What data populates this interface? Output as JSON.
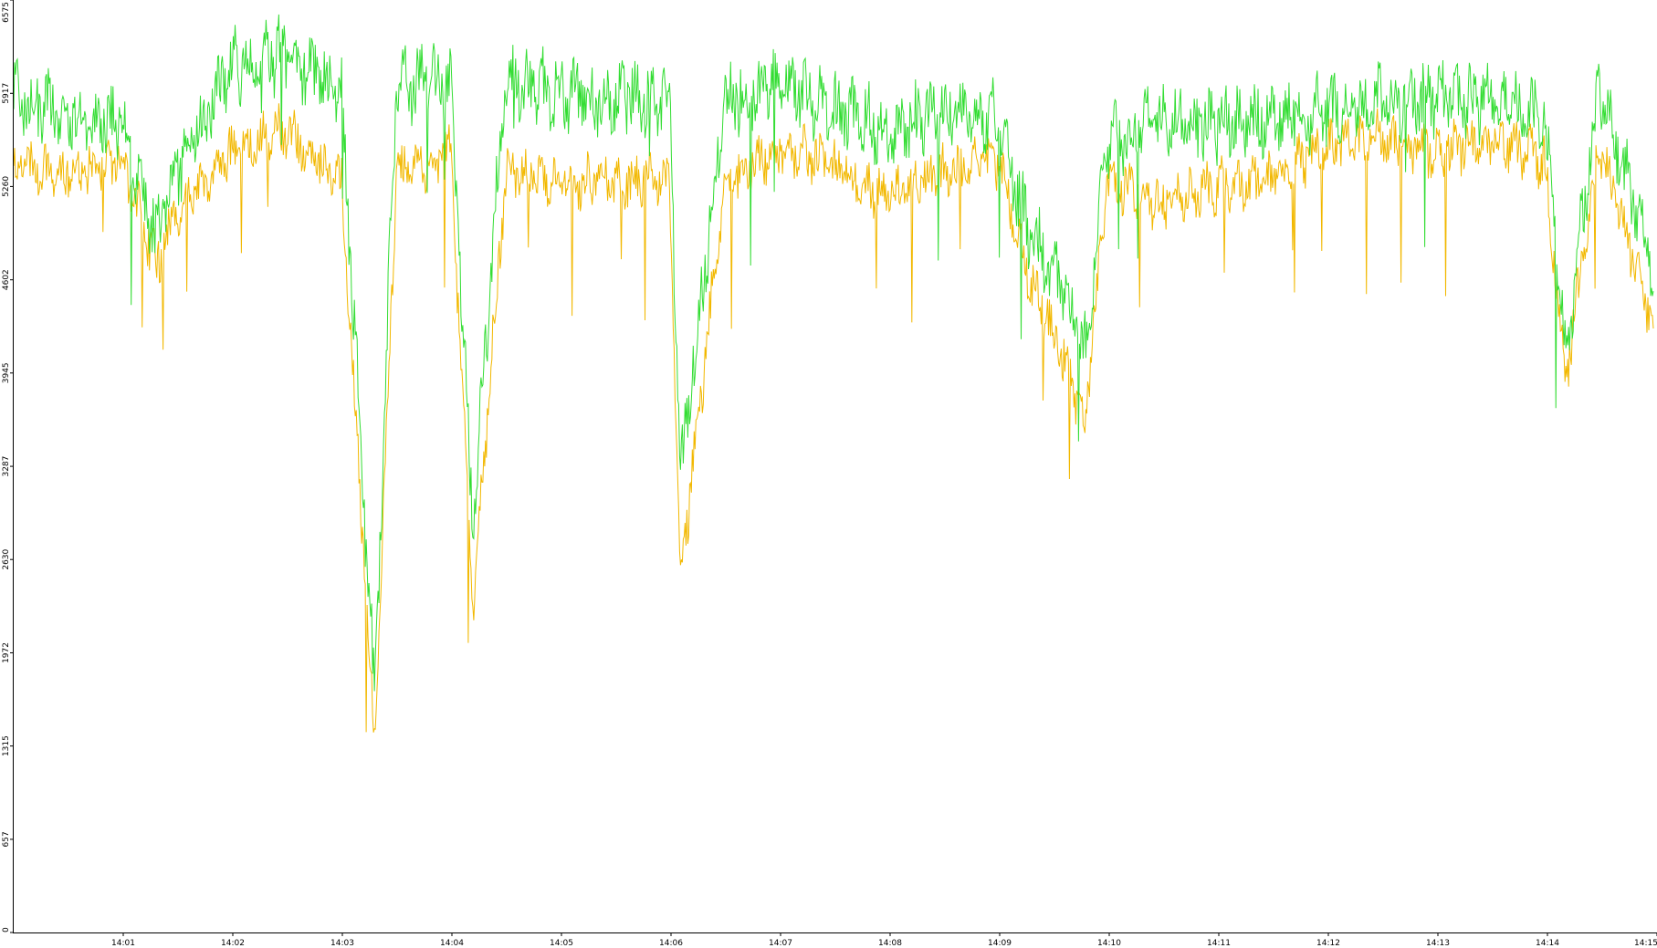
{
  "chart_data": {
    "type": "line",
    "title": "",
    "xlabel": "",
    "ylabel": "",
    "ylim": [
      0,
      6575
    ],
    "yticks": [
      0,
      657,
      1315,
      1972,
      2630,
      3287,
      3945,
      4602,
      5260,
      5917,
      6575
    ],
    "xticks": [
      "14:01",
      "14:02",
      "14:03",
      "14:04",
      "14:05",
      "14:06",
      "14:07",
      "14:08",
      "14:09",
      "14:10",
      "14:11",
      "14:12",
      "14:13",
      "14:14",
      "14:15"
    ],
    "x_minutes": [
      0,
      0.5,
      1.0,
      1.3,
      1.5,
      2.0,
      2.5,
      3.0,
      3.3,
      3.5,
      4.0,
      4.2,
      4.5,
      5.0,
      5.5,
      6.0,
      6.1,
      6.5,
      7.0,
      7.5,
      8.0,
      8.5,
      9.0,
      9.3,
      9.5,
      9.8,
      10.0,
      10.5,
      11.0,
      11.5,
      12.0,
      12.5,
      13.0,
      13.5,
      14.0,
      14.2,
      14.5,
      15.0
    ],
    "grid": false,
    "legend": "none",
    "series": [
      {
        "color": "#33dd33",
        "values": [
          5900,
          5750,
          5700,
          4900,
          5400,
          6100,
          6200,
          5900,
          1700,
          6000,
          6000,
          2900,
          6050,
          5900,
          5900,
          5900,
          3200,
          5850,
          6000,
          5800,
          5650,
          5800,
          5750,
          4900,
          4700,
          4100,
          5600,
          5700,
          5700,
          5750,
          5800,
          5850,
          5900,
          5850,
          5750,
          4100,
          5950,
          4700
        ]
      },
      {
        "color": "#f2b800",
        "values": [
          5400,
          5350,
          5450,
          4700,
          5100,
          5500,
          5650,
          5300,
          1400,
          5350,
          5500,
          2300,
          5350,
          5300,
          5300,
          5300,
          2500,
          5250,
          5550,
          5400,
          5200,
          5350,
          5450,
          4600,
          4250,
          3600,
          5300,
          5150,
          5250,
          5300,
          5550,
          5600,
          5500,
          5600,
          5450,
          3900,
          5550,
          4300
        ]
      }
    ]
  }
}
